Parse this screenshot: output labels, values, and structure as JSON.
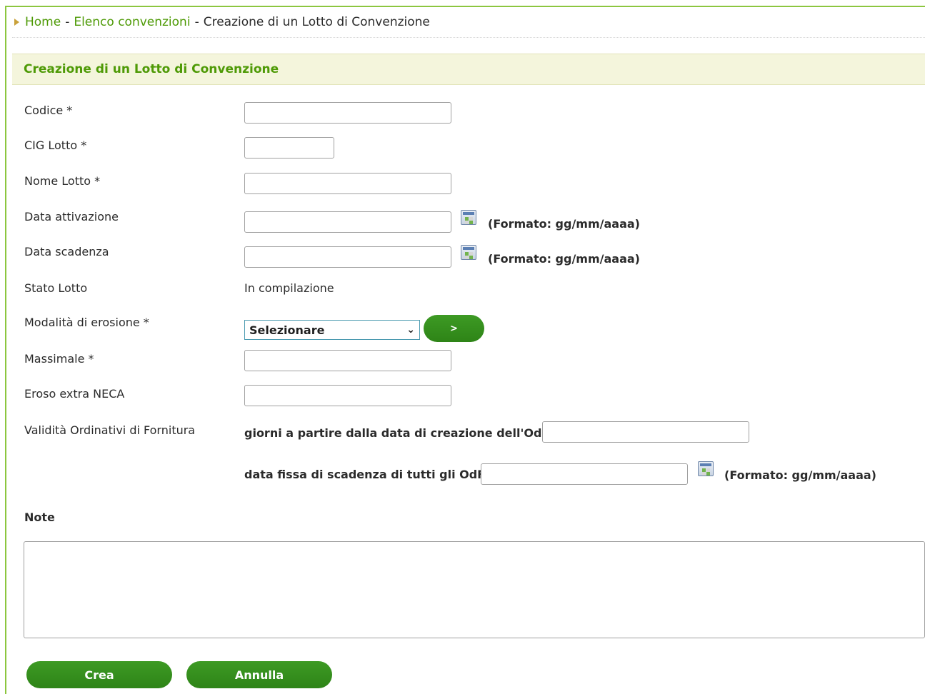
{
  "breadcrumb": {
    "home": "Home",
    "list": "Elenco convenzioni",
    "separator": "-",
    "current": "Creazione di un Lotto di Convenzione"
  },
  "section_title": "Creazione di un Lotto di Convenzione",
  "form": {
    "codice_label": "Codice *",
    "codice_value": "",
    "cig_label": "CIG Lotto *",
    "cig_value": "",
    "nome_label": "Nome Lotto *",
    "nome_value": "",
    "data_attivazione_label": "Data attivazione",
    "data_attivazione_value": "",
    "data_scadenza_label": "Data scadenza",
    "data_scadenza_value": "",
    "date_format_hint": "(Formato: gg/mm/aaaa)",
    "stato_label": "Stato Lotto",
    "stato_value": "In compilazione",
    "modalita_label": "Modalità di erosione *",
    "modalita_selected": "Selezionare",
    "modalita_go_button": ">",
    "massimale_label": "Massimale *",
    "massimale_value": "",
    "eroso_label": "Eroso extra NECA",
    "eroso_value": "",
    "validita_label": "Validità Ordinativi di Fornitura",
    "giorni_label": "giorni a partire dalla data di creazione dell'OdF:",
    "giorni_value": "",
    "data_fissa_label": "data fissa di scadenza di tutti gli OdF:",
    "data_fissa_value": "",
    "note_label": "Note",
    "note_value": ""
  },
  "buttons": {
    "crea": "Crea",
    "annulla": "Annulla"
  },
  "colors": {
    "accent_green": "#4e9a06",
    "button_green": "#2e8417",
    "header_bg": "#f4f5dc",
    "frame_border": "#8cc63f"
  }
}
